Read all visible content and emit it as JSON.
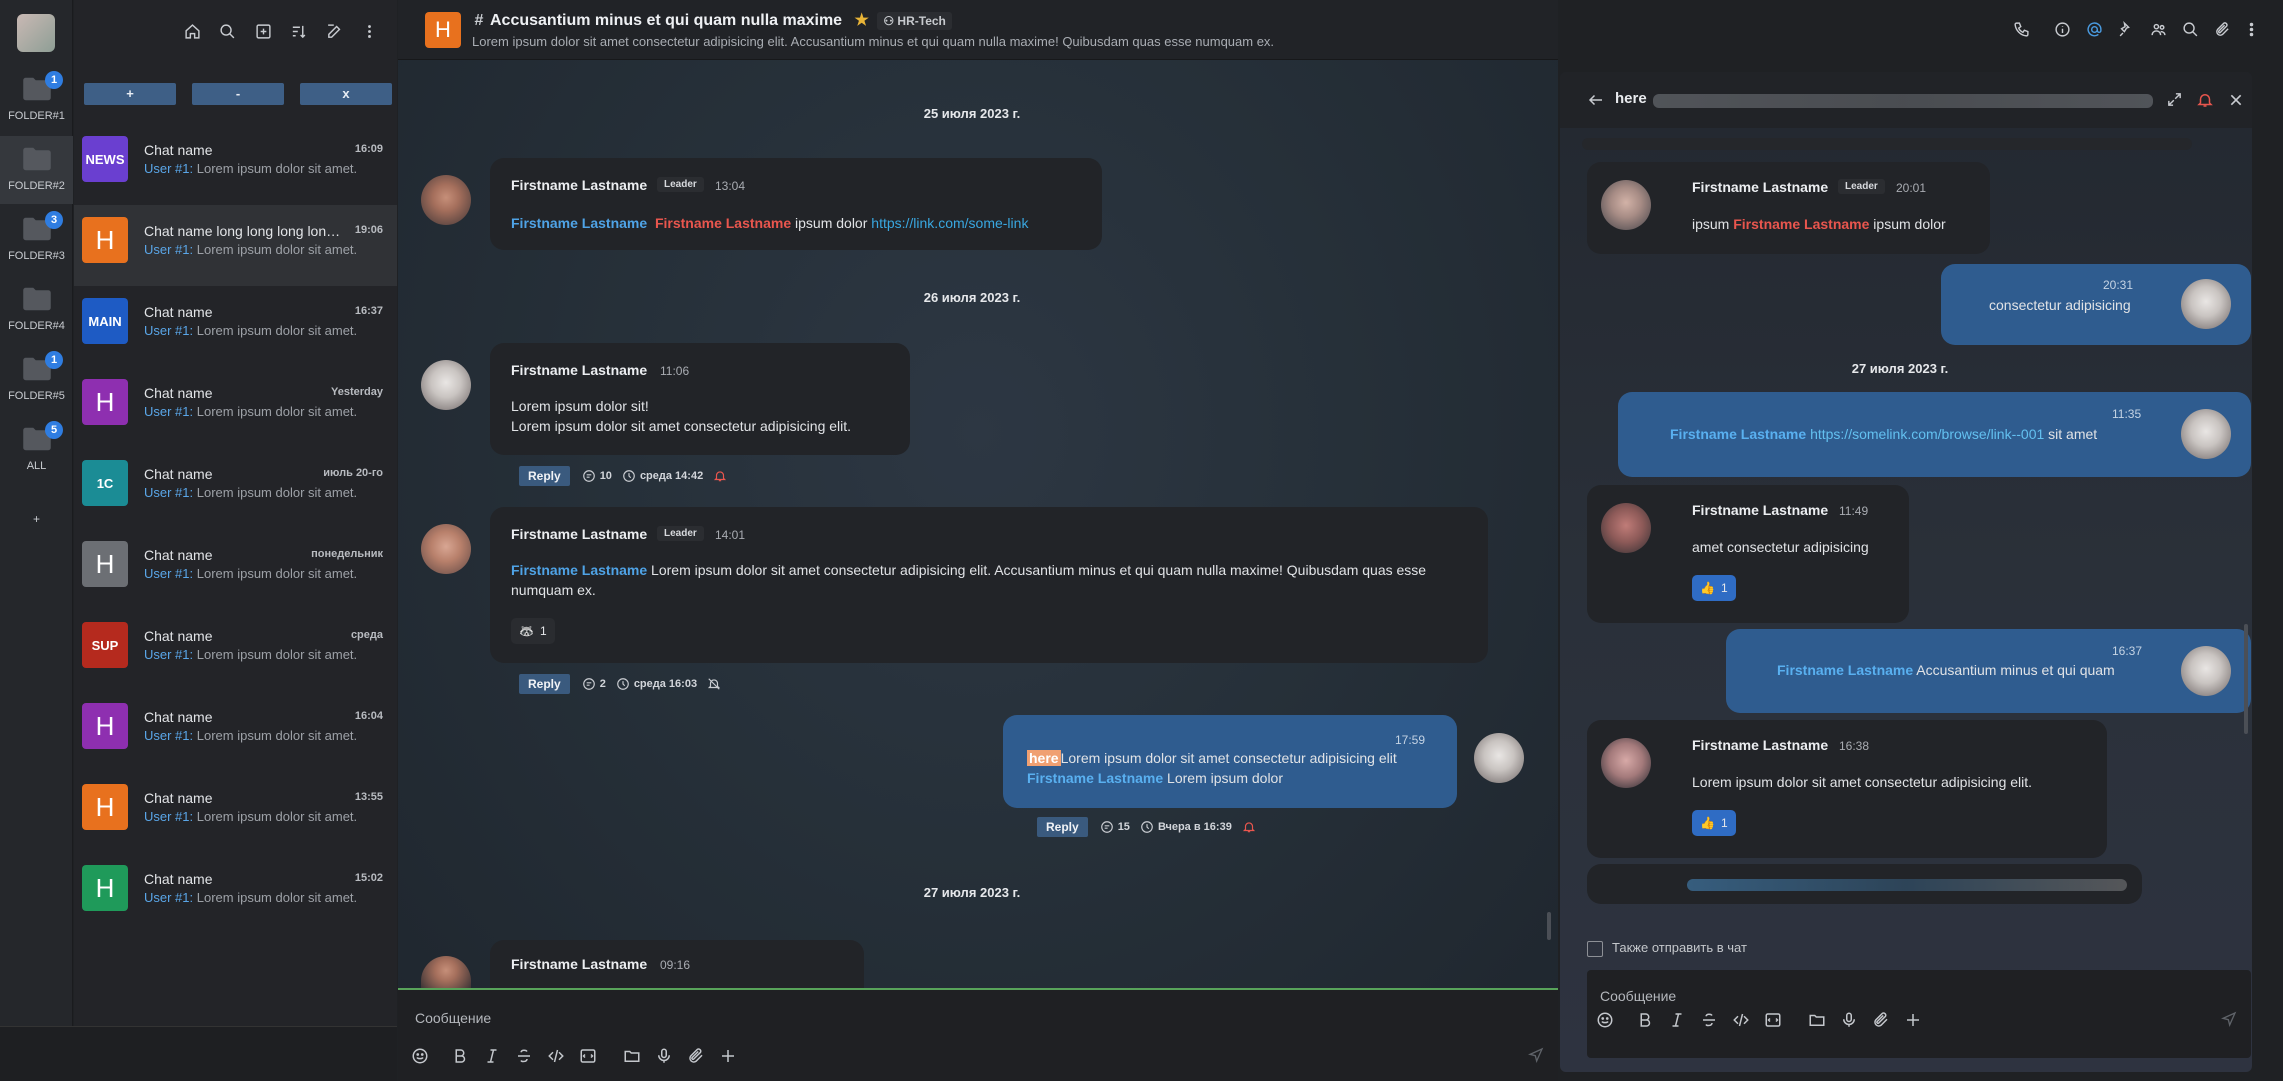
{
  "rail": {
    "folders": [
      {
        "label": "FOLDER#1",
        "badge": "1"
      },
      {
        "label": "FOLDER#2",
        "badge": ""
      },
      {
        "label": "FOLDER#3",
        "badge": "3"
      },
      {
        "label": "FOLDER#4",
        "badge": ""
      },
      {
        "label": "FOLDER#5",
        "badge": "1"
      },
      {
        "label": "ALL",
        "badge": "5"
      }
    ],
    "add_label": "+"
  },
  "chatlist": {
    "filter_buttons": [
      "+",
      "-",
      "x"
    ],
    "chats": [
      {
        "avatar": "NEWS",
        "avatar_color": "#6a3fd0",
        "name": "Chat name",
        "time": "16:09",
        "sender": "User #1:",
        "preview": " Lorem ipsum dolor sit amet."
      },
      {
        "avatar": "H",
        "avatar_color": "#e8711e",
        "name": "Chat name long long long long long",
        "time": "19:06",
        "sender": "User #1:",
        "preview": " Lorem ipsum dolor sit amet."
      },
      {
        "avatar": "MAIN",
        "avatar_color": "#1e5bc4",
        "name": "Chat name",
        "time": "16:37",
        "sender": "User #1:",
        "preview": " Lorem ipsum dolor sit amet."
      },
      {
        "avatar": "H",
        "avatar_color": "#8e2fb0",
        "name": "Chat name",
        "time": "Yesterday",
        "sender": "User #1:",
        "preview": " Lorem ipsum dolor sit amet."
      },
      {
        "avatar": "1C",
        "avatar_color": "#1b8c95",
        "name": "Chat name",
        "time": "июль 20-го",
        "sender": "User #1:",
        "preview": " Lorem ipsum dolor sit amet."
      },
      {
        "avatar": "H",
        "avatar_color": "#6c6f74",
        "name": "Chat name",
        "time": "понедельник",
        "sender": "User #1:",
        "preview": " Lorem ipsum dolor sit amet."
      },
      {
        "avatar": "SUP",
        "avatar_color": "#b52a1e",
        "name": "Chat name",
        "time": "среда",
        "sender": "User #1:",
        "preview": " Lorem ipsum dolor sit amet."
      },
      {
        "avatar": "H",
        "avatar_color": "#8e2fb0",
        "name": "Chat name",
        "time": "16:04",
        "sender": "User #1:",
        "preview": " Lorem ipsum dolor sit amet."
      },
      {
        "avatar": "H",
        "avatar_color": "#e8711e",
        "name": "Chat name",
        "time": "13:55",
        "sender": "User #1:",
        "preview": " Lorem ipsum dolor sit amet."
      },
      {
        "avatar": "H",
        "avatar_color": "#1f9a5a",
        "name": "Chat name",
        "time": "15:02",
        "sender": "User #1:",
        "preview": " Lorem ipsum dolor sit amet."
      }
    ]
  },
  "header": {
    "avatar": "H",
    "title": "Accusantium minus et qui quam nulla maxime",
    "team": "HR-Tech",
    "description": "Lorem ipsum dolor sit amet consectetur adipisicing elit. Accusantium minus et qui quam nulla maxime! Quibusdam quas esse numquam ex."
  },
  "messages": {
    "date1": "25 июля 2023 г.",
    "m1": {
      "author": "Firstname Lastname",
      "tag": "Leader",
      "time": "13:04",
      "mention1": "Firstname Lastname",
      "mention2": "Firstname Lastname",
      "text": " ipsum dolor ",
      "link": "https://link.com/some-link"
    },
    "date2": "26 июля 2023 г.",
    "m2": {
      "author": "Firstname Lastname",
      "time": "11:06",
      "line1": "Lorem ipsum dolor sit!",
      "line2": "Lorem ipsum dolor sit amet consectetur adipisicing elit.",
      "reply": "Reply",
      "count": "10",
      "last": "среда 14:42"
    },
    "m3": {
      "author": "Firstname Lastname",
      "tag": "Leader",
      "time": "14:01",
      "mention": "Firstname Lastname",
      "text": " Lorem ipsum dolor sit amet consectetur adipisicing elit. Accusantium minus et qui quam nulla maxime! Quibusdam quas esse numquam ex.",
      "reaction_count": "1",
      "reply": "Reply",
      "count": "2",
      "last": "среда 16:03"
    },
    "m4": {
      "time": "17:59",
      "here": "here",
      "text1": "Lorem ipsum dolor sit amet consectetur adipisicing elit",
      "mention": "Firstname Lastname",
      "text2": " Lorem ipsum dolor",
      "reply": "Reply",
      "count": "15",
      "last": "Вчера в 16:39"
    },
    "date3": "27 июля 2023 г.",
    "m5": {
      "author": "Firstname Lastname",
      "time": "09:16"
    }
  },
  "composer": {
    "placeholder": "Сообщение"
  },
  "thread": {
    "title": "here",
    "t1": {
      "author": "Firstname Lastname",
      "tag": "Leader",
      "time": "20:01",
      "pre": "ipsum ",
      "mention": "Firstname Lastname",
      "post": " ipsum dolor"
    },
    "t2": {
      "time": "20:31",
      "text": "consectetur adipisicing"
    },
    "date": "27 июля 2023 г.",
    "t3": {
      "time": "11:35",
      "mention": "Firstname Lastname",
      "link": "https://somelink.com/browse/link--001",
      "post": " sit amet"
    },
    "t4": {
      "author": "Firstname Lastname",
      "time": "11:49",
      "text": "amet consectetur adipisicing",
      "reaction_count": "1"
    },
    "t5": {
      "time": "16:37",
      "mention": "Firstname Lastname",
      "text": " Accusantium minus et qui quam"
    },
    "t6": {
      "author": "Firstname Lastname",
      "time": "16:38",
      "text": "Lorem ipsum dolor sit amet consectetur adipisicing elit.",
      "reaction_count": "1"
    },
    "also_send": "Также отправить в чат",
    "placeholder": "Сообщение"
  }
}
